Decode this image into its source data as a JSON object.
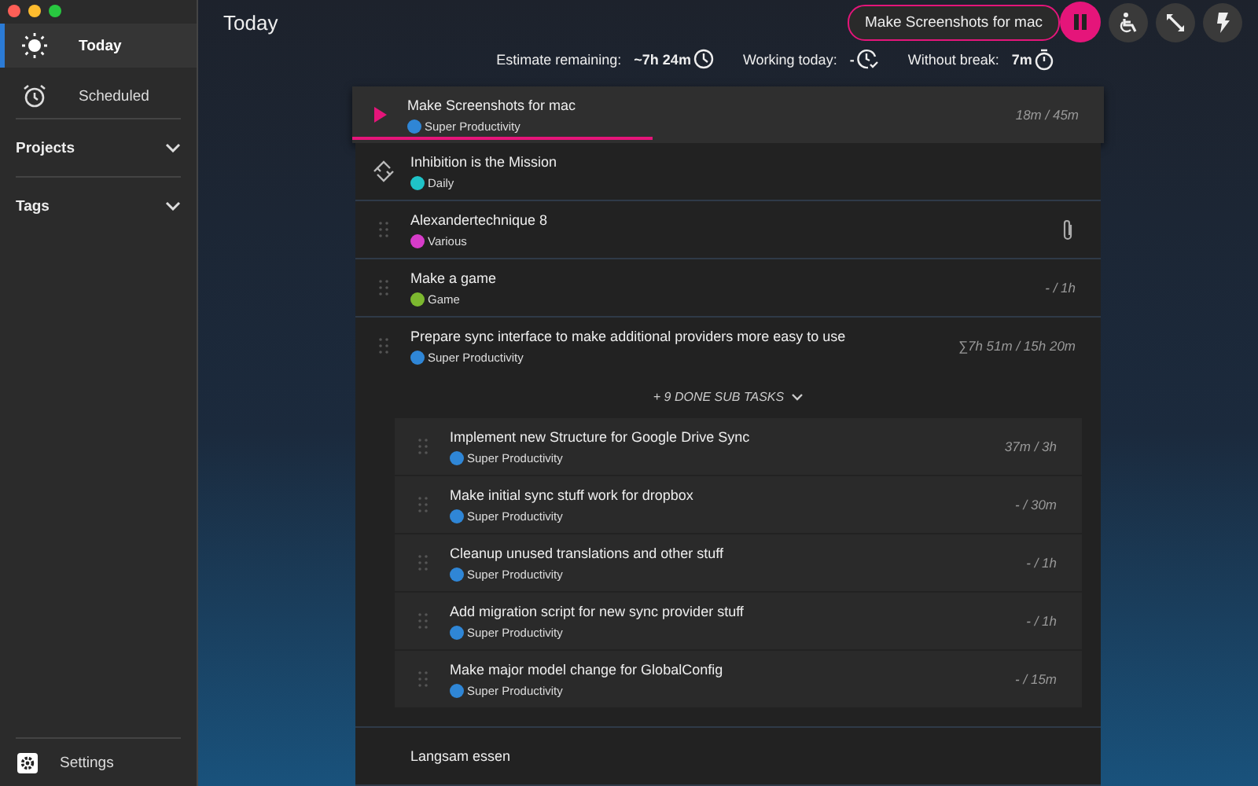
{
  "sidebar": {
    "nav": [
      {
        "label": "Today",
        "selected": true
      },
      {
        "label": "Scheduled",
        "selected": false
      }
    ],
    "sections": [
      {
        "label": "Projects",
        "expanded": false
      },
      {
        "label": "Tags",
        "expanded": false
      }
    ],
    "settings": {
      "label": "Settings"
    }
  },
  "header": {
    "title": "Today",
    "current_task": "Make Screenshots for mac",
    "tracking": true
  },
  "stats": [
    {
      "label": "Estimate remaining:",
      "value": "~7h 24m"
    },
    {
      "label": "Working today:",
      "value": "-"
    },
    {
      "label": "Without break:",
      "value": "7m"
    }
  ],
  "tasks": [
    {
      "title": "Make Screenshots for mac",
      "project": "Super Productivity",
      "color": "#2f86d6",
      "time": "18m / 45m",
      "current": true,
      "level": 0.4,
      "kind": "play",
      "attachment": false
    },
    {
      "title": "Inhibition is the Mission",
      "project": "Daily",
      "color": "#1fc3c8",
      "current": false,
      "kind": "repeat",
      "attachment": false
    },
    {
      "title": "Alexandertechnique 8",
      "project": "Various",
      "color": "#d63cc9",
      "current": false,
      "kind": "drag",
      "attachment": true
    },
    {
      "title": "Make a game",
      "project": "Game",
      "color": "#7cb82f",
      "time": "- / 1h",
      "current": false,
      "kind": "drag",
      "attachment": false
    },
    {
      "title": "Prepare sync interface to make additional providers more easy to use",
      "project": "Super Productivity",
      "color": "#2f86d6",
      "time": "∑7h 51m / 15h 20m",
      "current": false,
      "kind": "drag",
      "attachment": false,
      "done_toggle": "+ 9 DONE SUB TASKS",
      "children": [
        {
          "title": "Implement new Structure for Google Drive Sync",
          "project": "Super Productivity",
          "color": "#2f86d6",
          "time": "37m / 3h",
          "current": false,
          "kind": "drag",
          "attachment": false
        },
        {
          "title": "Make initial sync stuff work for dropbox",
          "project": "Super Productivity",
          "color": "#2f86d6",
          "time": "- / 30m",
          "current": false,
          "kind": "drag",
          "attachment": false
        },
        {
          "title": "Cleanup unused translations and other stuff",
          "project": "Super Productivity",
          "color": "#2f86d6",
          "time": "- / 1h",
          "current": false,
          "kind": "drag",
          "attachment": false
        },
        {
          "title": "Add migration script for new sync provider stuff",
          "project": "Super Productivity",
          "color": "#2f86d6",
          "time": "- / 1h",
          "current": false,
          "kind": "drag",
          "attachment": false
        },
        {
          "title": "Make major model change for GlobalConfig",
          "project": "Super Productivity",
          "color": "#2f86d6",
          "time": "- / 15m",
          "current": false,
          "kind": "drag",
          "attachment": false
        }
      ]
    },
    {
      "title": "Langsam essen",
      "current": false,
      "kind": "none",
      "attachment": false
    }
  ]
}
